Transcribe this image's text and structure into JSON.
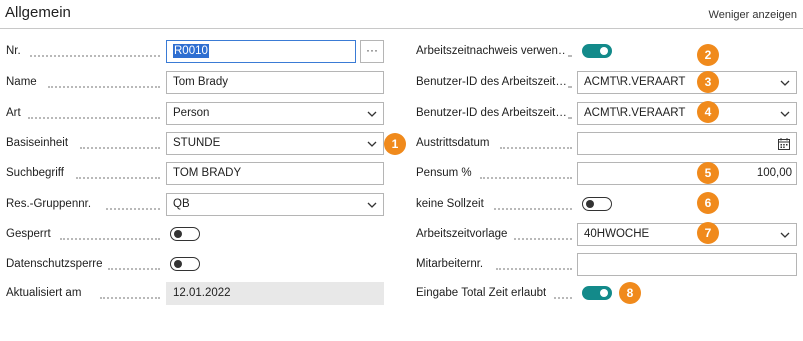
{
  "section": {
    "title": "Allgemein",
    "less_link": "Weniger anzeigen"
  },
  "left_fields": [
    {
      "label": "Nr.",
      "value": "R0010"
    },
    {
      "label": "Name",
      "value": "Tom Brady"
    },
    {
      "label": "Art",
      "value": "Person"
    },
    {
      "label": "Basiseinheit",
      "value": "STUNDE"
    },
    {
      "label": "Suchbegriff",
      "value": "TOM BRADY"
    },
    {
      "label": "Res.-Gruppennr.",
      "value": "QB"
    },
    {
      "label": "Gesperrt",
      "toggle": false
    },
    {
      "label": "Datenschutzsperre",
      "toggle": false
    },
    {
      "label": "Aktualisiert am",
      "value": "12.01.2022"
    }
  ],
  "right_fields": [
    {
      "label": "Arbeitszeitnachweis verwen…",
      "toggle": true
    },
    {
      "label": "Benutzer-ID des Arbeitszeit…",
      "value": "ACMT\\R.VERAART"
    },
    {
      "label": "Benutzer-ID des Arbeitszeit…",
      "value": "ACMT\\R.VERAART"
    },
    {
      "label": "Austrittsdatum",
      "value": ""
    },
    {
      "label": "Pensum %",
      "value": "100,00"
    },
    {
      "label": "keine Sollzeit",
      "toggle": false
    },
    {
      "label": "Arbeitszeitvorlage",
      "value": "40HWOCHE"
    },
    {
      "label": "Mitarbeiternr.",
      "value": ""
    },
    {
      "label": "Eingabe Total Zeit erlaubt",
      "toggle": true
    }
  ],
  "ellipsis": "···",
  "badges": [
    "1",
    "2",
    "3",
    "4",
    "5",
    "6",
    "7",
    "8"
  ],
  "colors": {
    "accent_toggle": "#138a8a",
    "badge": "#f08a1c",
    "selection": "#2f6fd1"
  },
  "icons": {
    "dropdown": "chevron-down-icon",
    "date": "calendar-icon"
  }
}
